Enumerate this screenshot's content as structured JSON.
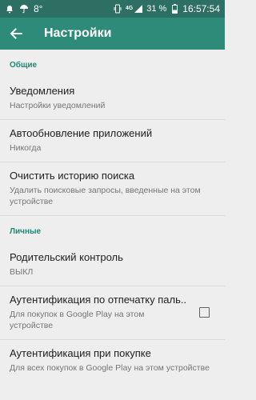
{
  "statusbar": {
    "left_icons": [
      "notification-icon",
      "umbrella-icon"
    ],
    "temperature": "8°",
    "network_type": "4G",
    "battery": "31 %",
    "time": "16:57:54"
  },
  "appbar": {
    "title": "Настройки"
  },
  "sections": [
    {
      "header": "Общие",
      "items": [
        {
          "title": "Уведомления",
          "subtitle": "Настройки уведомлений"
        },
        {
          "title": "Автообновление приложений",
          "subtitle": "Никогда"
        },
        {
          "title": "Очистить историю поиска",
          "subtitle": "Удалить поисковые запросы, введенные на этом устройстве"
        }
      ]
    },
    {
      "header": "Личные",
      "items": [
        {
          "title": "Родительский контроль",
          "subtitle": "ВЫКЛ"
        },
        {
          "title": "Аутентификация по отпечатку паль..",
          "subtitle": "Для покупок в Google Play на этом устройстве",
          "checked": false
        },
        {
          "title": "Аутентификация при покупке",
          "subtitle": "Для всех покупок в Google Play на этом устройстве"
        }
      ]
    }
  ],
  "colors": {
    "statusbar": "#2e6f63",
    "appbar": "#2e8b7a",
    "accent": "#1e8a77",
    "background": "#eeeeee"
  }
}
